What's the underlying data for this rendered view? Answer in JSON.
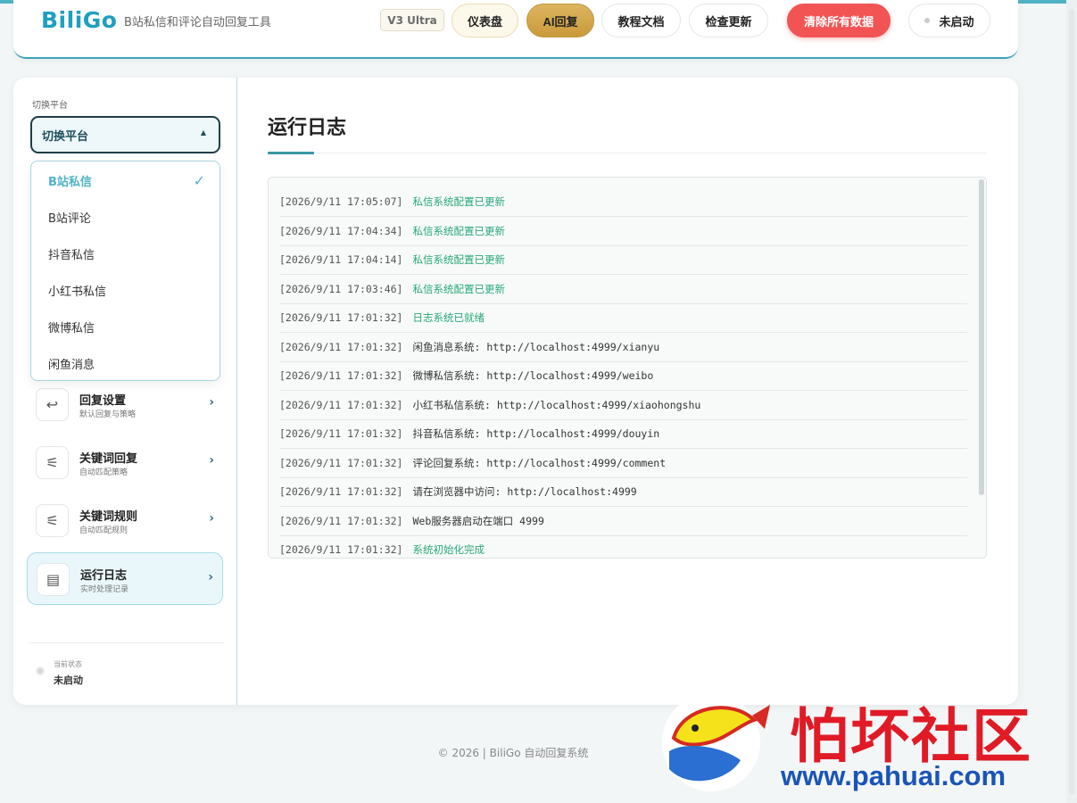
{
  "header": {
    "logo": "BiliGo",
    "subtitle": "B站私信和评论自动回复工具",
    "version": "V3 Ultra",
    "buttons": {
      "dashboard": "仪表盘",
      "ai_reply": "AI回复",
      "docs": "教程文档",
      "check_update": "检查更新",
      "clear_data": "清除所有数据",
      "status": "未启动"
    }
  },
  "sidebar": {
    "platform_label": "切换平台",
    "platform_select": "切换平台",
    "platforms": [
      {
        "label": "B站私信",
        "selected": true
      },
      {
        "label": "B站评论",
        "selected": false
      },
      {
        "label": "抖音私信",
        "selected": false
      },
      {
        "label": "小红书私信",
        "selected": false
      },
      {
        "label": "微博私信",
        "selected": false
      },
      {
        "label": "闲鱼消息",
        "selected": false
      }
    ],
    "check_mark": "✓",
    "nav": [
      {
        "title": "回复设置",
        "desc": "默认回复与策略",
        "icon": "reply-icon",
        "glyph": "↩"
      },
      {
        "title": "关键词回复",
        "desc": "自动匹配策略",
        "icon": "sliders-icon",
        "glyph": "⚟"
      },
      {
        "title": "关键词规则",
        "desc": "自动匹配规则",
        "icon": "sliders-icon",
        "glyph": "⚟"
      },
      {
        "title": "运行日志",
        "desc": "实时处理记录",
        "icon": "document-icon",
        "glyph": "▤",
        "active": true
      }
    ],
    "state_label": "当前状态",
    "state_value": "未启动"
  },
  "main": {
    "title": "运行日志",
    "logs": [
      {
        "ts": "[2026/9/11 17:05:07]",
        "msg": "私信系统配置已更新",
        "green": true
      },
      {
        "ts": "[2026/9/11 17:04:34]",
        "msg": "私信系统配置已更新",
        "green": true
      },
      {
        "ts": "[2026/9/11 17:04:14]",
        "msg": "私信系统配置已更新",
        "green": true
      },
      {
        "ts": "[2026/9/11 17:03:46]",
        "msg": "私信系统配置已更新",
        "green": true
      },
      {
        "ts": "[2026/9/11 17:01:32]",
        "msg": "日志系统已就绪",
        "green": true
      },
      {
        "ts": "[2026/9/11 17:01:32]",
        "msg": "闲鱼消息系统: http://localhost:4999/xianyu",
        "green": false
      },
      {
        "ts": "[2026/9/11 17:01:32]",
        "msg": "微博私信系统: http://localhost:4999/weibo",
        "green": false
      },
      {
        "ts": "[2026/9/11 17:01:32]",
        "msg": "小红书私信系统: http://localhost:4999/xiaohongshu",
        "green": false
      },
      {
        "ts": "[2026/9/11 17:01:32]",
        "msg": "抖音私信系统: http://localhost:4999/douyin",
        "green": false
      },
      {
        "ts": "[2026/9/11 17:01:32]",
        "msg": "评论回复系统: http://localhost:4999/comment",
        "green": false
      },
      {
        "ts": "[2026/9/11 17:01:32]",
        "msg": "请在浏览器中访问: http://localhost:4999",
        "green": false
      },
      {
        "ts": "[2026/9/11 17:01:32]",
        "msg": "Web服务器启动在端口 4999",
        "green": false
      },
      {
        "ts": "[2026/9/11 17:01:32]",
        "msg": "系统初始化完成",
        "green": true
      }
    ]
  },
  "footer": {
    "text": "© 2026 | BiliGo 自动回复系统"
  },
  "watermark": {
    "zh": "怕坏社区",
    "url": "www.pahuai.com"
  }
}
